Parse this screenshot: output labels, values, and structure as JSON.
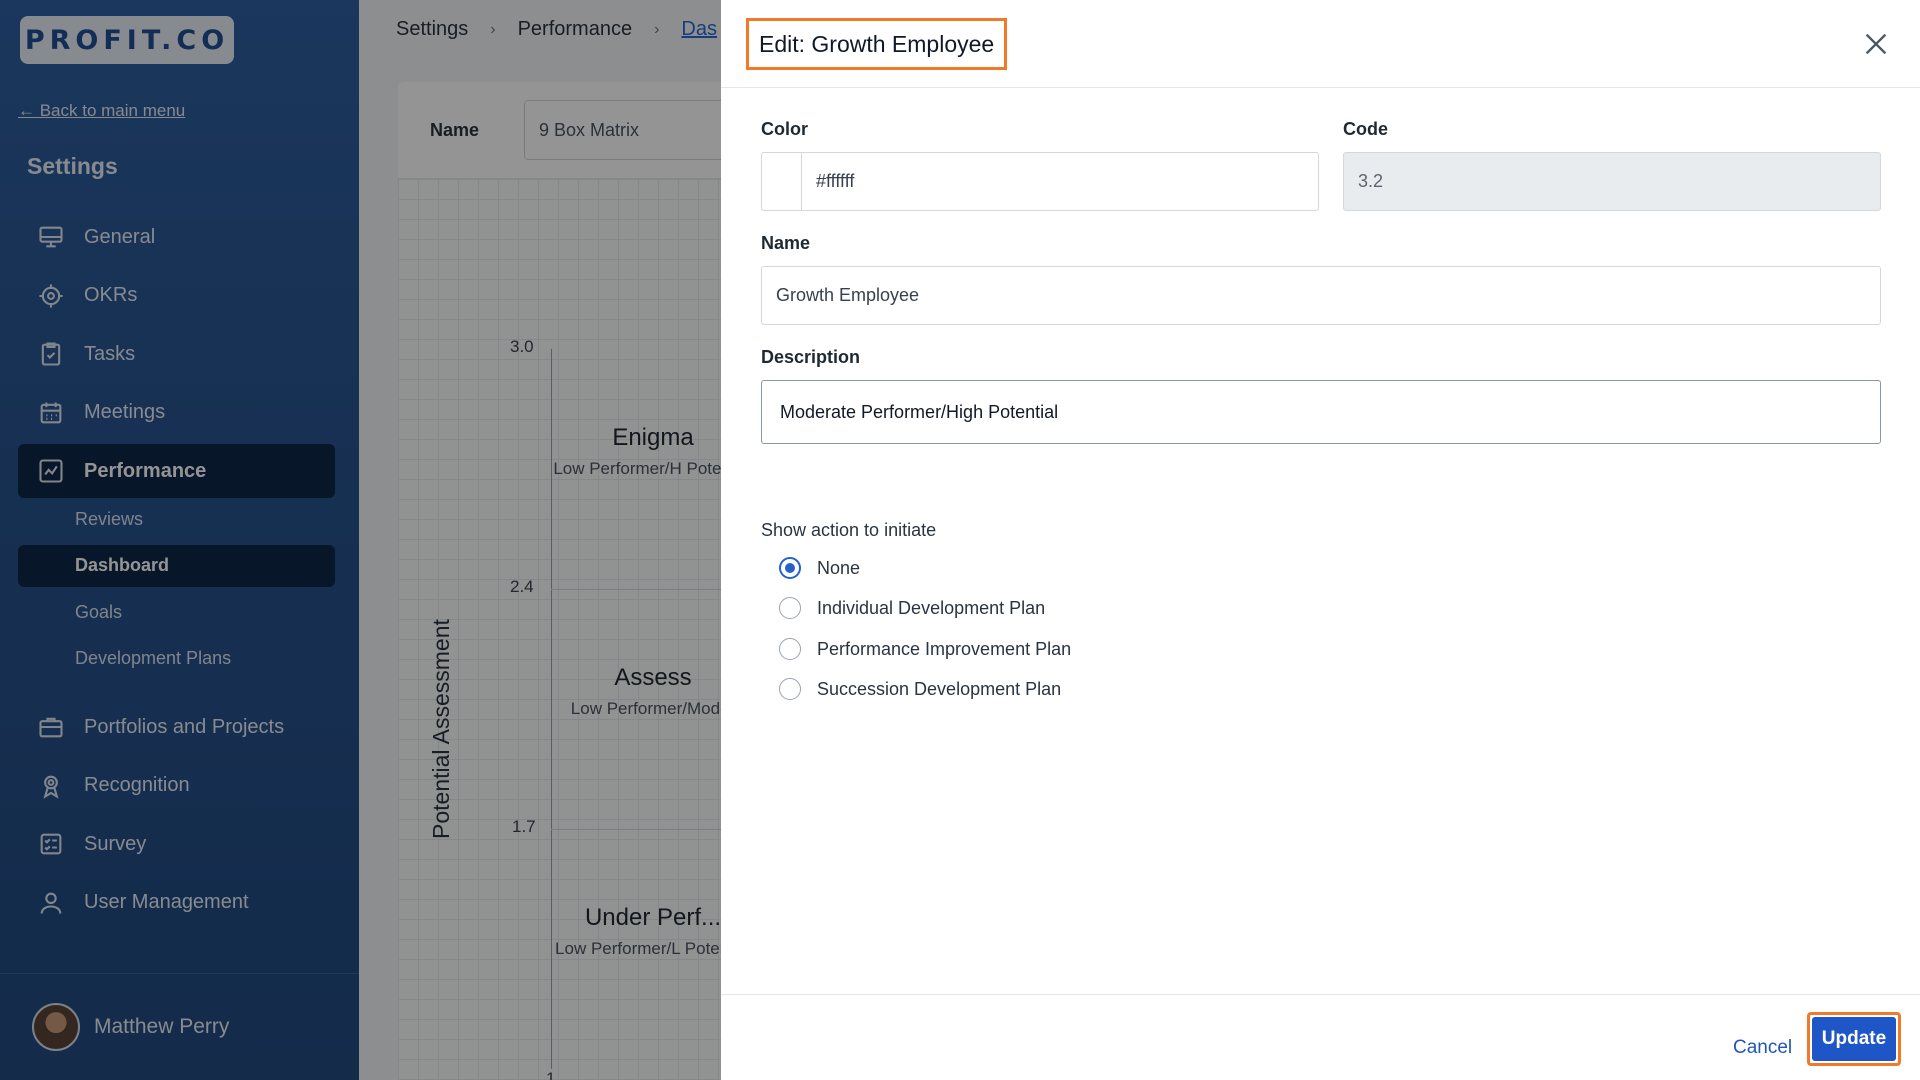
{
  "sidebar": {
    "logo": "PROFIT.CO",
    "back_link": "← Back to main menu",
    "title": "Settings",
    "items": [
      {
        "label": "General",
        "icon": "monitor-icon"
      },
      {
        "label": "OKRs",
        "icon": "target-icon"
      },
      {
        "label": "Tasks",
        "icon": "clipboard-check-icon"
      },
      {
        "label": "Meetings",
        "icon": "calendar-icon"
      },
      {
        "label": "Performance",
        "icon": "chart-line-icon"
      }
    ],
    "sub_items": [
      {
        "label": "Reviews"
      },
      {
        "label": "Dashboard"
      },
      {
        "label": "Goals"
      },
      {
        "label": "Development Plans"
      }
    ],
    "items2": [
      {
        "label": "Portfolios and Projects",
        "icon": "briefcase-icon"
      },
      {
        "label": "Recognition",
        "icon": "award-icon"
      },
      {
        "label": "Survey",
        "icon": "checklist-icon"
      },
      {
        "label": "User Management",
        "icon": "user-icon"
      }
    ],
    "user": {
      "name": "Matthew Perry"
    }
  },
  "main": {
    "breadcrumb": [
      "Settings",
      "Performance",
      "Das"
    ],
    "name_label": "Name",
    "name_value": "9 Box Matrix",
    "chart": {
      "y_axis_title": "Potential Assessment",
      "y_ticks": [
        "3.0",
        "2.4",
        "1.7",
        "1"
      ],
      "cells": [
        {
          "title": "Enigma",
          "desc": "Low Performer/H Potential"
        },
        {
          "title": "Assess",
          "desc": "Low Performer/Moder"
        },
        {
          "title": "Under Perf...",
          "desc": "Low Performer/L Potential"
        }
      ]
    }
  },
  "drawer": {
    "title": "Edit: Growth Employee",
    "color_label": "Color",
    "color_value": "#ffffff",
    "code_label": "Code",
    "code_value": "3.2",
    "name_label": "Name",
    "name_value": "Growth Employee",
    "description_label": "Description",
    "description_value": "Moderate Performer/High Potential",
    "action_title": "Show action to initiate",
    "actions": [
      {
        "label": "None",
        "checked": true
      },
      {
        "label": "Individual Development Plan",
        "checked": false
      },
      {
        "label": "Performance Improvement Plan",
        "checked": false
      },
      {
        "label": "Succession Development Plan",
        "checked": false
      }
    ],
    "cancel_label": "Cancel",
    "update_label": "Update"
  },
  "colors": {
    "sidebar_bg": "#2a5793",
    "active_nav": "#0f2747",
    "primary": "#1f56c7",
    "highlight": "#f07a2a"
  }
}
